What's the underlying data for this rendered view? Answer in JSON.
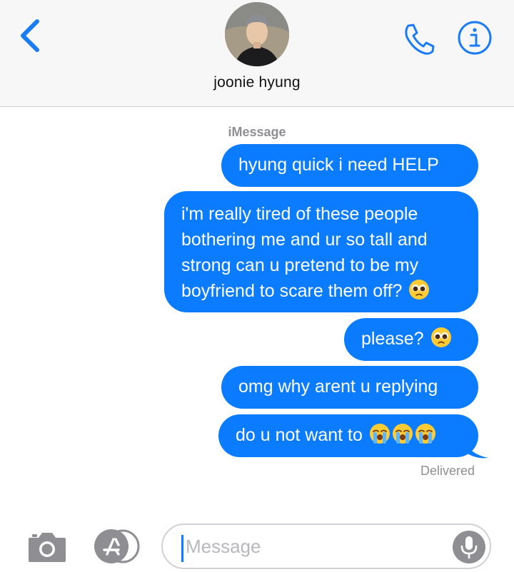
{
  "header": {
    "contact_name": "joonie hyung",
    "back_icon": "chevron-left-icon",
    "call_icon": "phone-icon",
    "info_icon": "info-icon"
  },
  "conversation": {
    "service_label": "iMessage",
    "messages": [
      {
        "text": "hyung quick i need HELP",
        "emoji": ""
      },
      {
        "text": "i'm really tired of these people bothering me and ur so tall and strong can u pretend to be my boyfriend to scare them off?",
        "emoji": "pleading-face"
      },
      {
        "text": "please?",
        "emoji": "pleading-face"
      },
      {
        "text": "omg why arent u replying",
        "emoji": ""
      },
      {
        "text": "do u not want to",
        "emoji": "loudly-crying-face x3"
      }
    ],
    "status": "Delivered"
  },
  "composer": {
    "placeholder": "Message",
    "camera_icon": "camera-icon",
    "apps_icon": "app-store-icon",
    "mic_icon": "microphone-icon"
  },
  "colors": {
    "bubble": "#0b7cff",
    "accent": "#1a7cf5",
    "muted": "#8e8e93"
  }
}
